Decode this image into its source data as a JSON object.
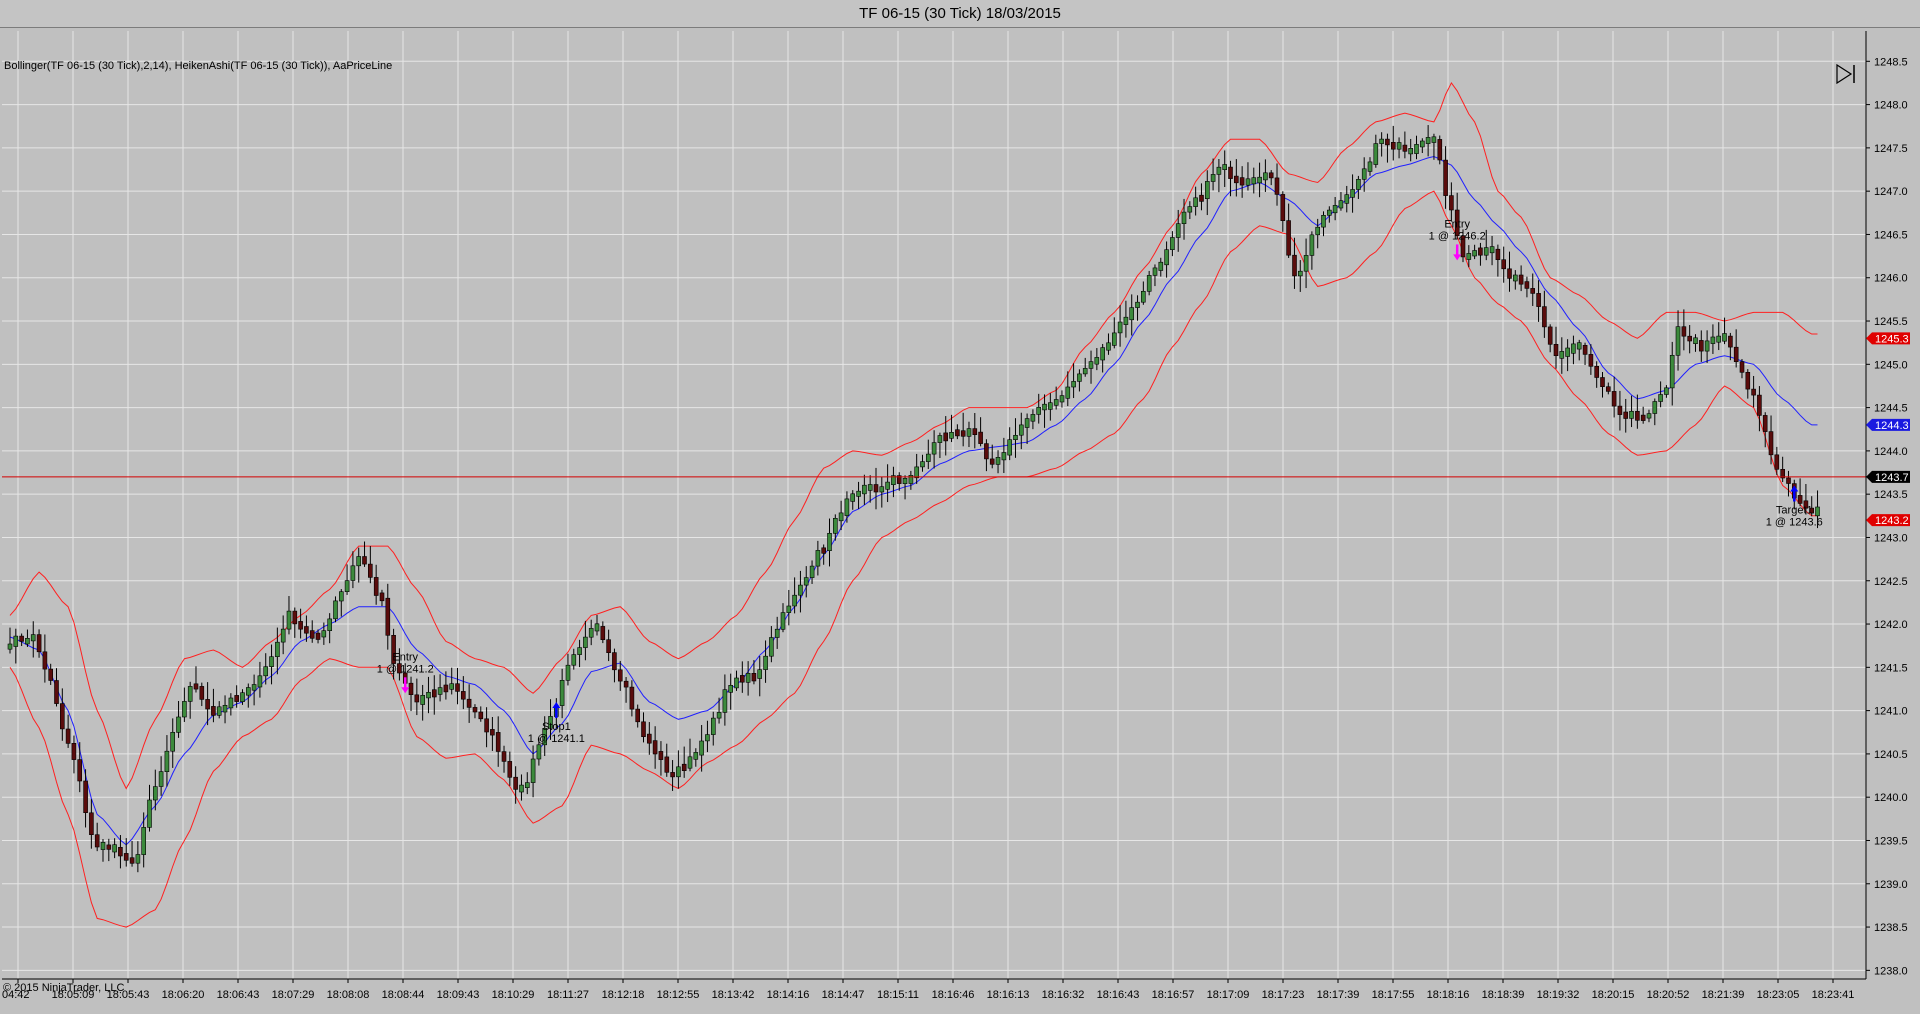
{
  "window": {
    "title": "TF 06-15 (30 Tick)  18/03/2015"
  },
  "chart": {
    "indicators_label": "Bollinger(TF 06-15 (30 Tick),2,14), HeikenAshi(TF 06-15 (30 Tick)), AaPriceLine",
    "copyright": "© 2015 NinjaTrader, LLC"
  },
  "colors": {
    "background": "#c0c0c0",
    "grid": "#e6e6e6",
    "bullish": "#3c8a3c",
    "bearish": "#5a0c0c",
    "bollinger_bands": "#ff2020",
    "bollinger_mid": "#2020ff",
    "price_line": "#d20000",
    "entry_marker": "#ff00ff",
    "exit_marker": "#0000ff"
  },
  "chart_data": {
    "type": "candlestick",
    "subtype": "heiken-ashi",
    "ylim": [
      1237.9,
      1248.85
    ],
    "y_ticks": [
      "1238.0",
      "1238.5",
      "1239.0",
      "1239.5",
      "1240.0",
      "1240.5",
      "1241.0",
      "1241.5",
      "1242.0",
      "1242.5",
      "1243.0",
      "1243.5",
      "1244.0",
      "1244.5",
      "1245.0",
      "1245.5",
      "1246.0",
      "1246.5",
      "1247.0",
      "1247.5",
      "1248.0",
      "1248.5"
    ],
    "x_ticks": [
      "04:42",
      "18:05:09",
      "18:05:43",
      "18:06:20",
      "18:06:43",
      "18:07:29",
      "18:08:08",
      "18:08:44",
      "18:09:43",
      "18:10:29",
      "18:11:27",
      "18:12:18",
      "18:12:55",
      "18:13:42",
      "18:14:16",
      "18:14:47",
      "18:15:11",
      "18:16:46",
      "18:16:13",
      "18:16:32",
      "18:16:43",
      "18:16:57",
      "18:17:09",
      "18:17:23",
      "18:17:39",
      "18:17:55",
      "18:18:16",
      "18:18:39",
      "18:19:32",
      "18:20:15",
      "18:20:52",
      "18:21:39",
      "18:23:05",
      "18:23:41"
    ],
    "grid": true,
    "price_line": 1243.7,
    "badges": [
      {
        "value": "1245.3",
        "price": 1245.3,
        "color": "#e00000"
      },
      {
        "value": "1244.3",
        "price": 1244.3,
        "color": "#1a1ae0"
      },
      {
        "value": "1243.7",
        "price": 1243.7,
        "color": "#000000"
      },
      {
        "value": "1243.2",
        "price": 1243.2,
        "color": "#e00000"
      }
    ],
    "close_anchors": [
      [
        0,
        1241.8
      ],
      [
        4,
        1241.85
      ],
      [
        6,
        1241.5
      ],
      [
        10,
        1240.6
      ],
      [
        15,
        1239.4
      ],
      [
        17,
        1239.45
      ],
      [
        21,
        1239.2
      ],
      [
        25,
        1240.1
      ],
      [
        28,
        1240.7
      ],
      [
        31,
        1241.3
      ],
      [
        35,
        1241.0
      ],
      [
        40,
        1241.15
      ],
      [
        44,
        1241.5
      ],
      [
        48,
        1242.1
      ],
      [
        53,
        1241.8
      ],
      [
        57,
        1242.4
      ],
      [
        60,
        1242.8
      ],
      [
        64,
        1242.25
      ],
      [
        66,
        1241.5
      ],
      [
        70,
        1241.1
      ],
      [
        76,
        1241.3
      ],
      [
        82,
        1240.8
      ],
      [
        88,
        1240.05
      ],
      [
        92,
        1240.8
      ],
      [
        97,
        1241.6
      ],
      [
        101,
        1242.0
      ],
      [
        105,
        1241.4
      ],
      [
        109,
        1240.7
      ],
      [
        114,
        1240.25
      ],
      [
        119,
        1240.6
      ],
      [
        124,
        1241.3
      ],
      [
        128,
        1241.4
      ],
      [
        133,
        1242.1
      ],
      [
        139,
        1242.8
      ],
      [
        144,
        1243.4
      ],
      [
        148,
        1243.55
      ],
      [
        155,
        1243.7
      ],
      [
        160,
        1244.15
      ],
      [
        165,
        1244.25
      ],
      [
        169,
        1243.8
      ],
      [
        174,
        1244.3
      ],
      [
        180,
        1244.6
      ],
      [
        186,
        1245.0
      ],
      [
        192,
        1245.55
      ],
      [
        198,
        1246.2
      ],
      [
        203,
        1246.8
      ],
      [
        208,
        1247.25
      ],
      [
        212,
        1247.15
      ],
      [
        216,
        1247.2
      ],
      [
        218,
        1247.0
      ],
      [
        221,
        1246.0
      ],
      [
        226,
        1246.7
      ],
      [
        232,
        1247.1
      ],
      [
        236,
        1247.6
      ],
      [
        240,
        1247.5
      ],
      [
        245,
        1247.6
      ],
      [
        247,
        1247.0
      ],
      [
        250,
        1246.3
      ],
      [
        254,
        1246.35
      ],
      [
        258,
        1246.0
      ],
      [
        262,
        1245.8
      ],
      [
        266,
        1245.1
      ],
      [
        270,
        1245.2
      ],
      [
        274,
        1244.7
      ],
      [
        278,
        1244.35
      ],
      [
        282,
        1244.45
      ],
      [
        285,
        1244.7
      ],
      [
        287,
        1245.4
      ],
      [
        291,
        1245.2
      ],
      [
        295,
        1245.3
      ],
      [
        300,
        1244.6
      ],
      [
        304,
        1243.8
      ],
      [
        309,
        1243.3
      ]
    ],
    "bollinger_anchors": [
      [
        0,
        1242.1,
        1241.85,
        1241.5
      ],
      [
        5,
        1242.6,
        1241.7,
        1240.8
      ],
      [
        10,
        1242.2,
        1241.0,
        1239.8
      ],
      [
        15,
        1241.0,
        1239.8,
        1238.6
      ],
      [
        20,
        1240.1,
        1239.45,
        1238.5
      ],
      [
        25,
        1240.9,
        1239.9,
        1238.7
      ],
      [
        30,
        1241.6,
        1240.5,
        1239.5
      ],
      [
        35,
        1241.7,
        1240.95,
        1240.3
      ],
      [
        40,
        1241.5,
        1241.1,
        1240.7
      ],
      [
        45,
        1241.8,
        1241.4,
        1240.9
      ],
      [
        50,
        1242.1,
        1241.8,
        1241.35
      ],
      [
        55,
        1242.4,
        1242.0,
        1241.6
      ],
      [
        60,
        1242.9,
        1242.2,
        1241.5
      ],
      [
        65,
        1242.9,
        1242.2,
        1241.5
      ],
      [
        70,
        1242.4,
        1241.7,
        1240.7
      ],
      [
        75,
        1241.8,
        1241.4,
        1240.45
      ],
      [
        80,
        1241.6,
        1241.3,
        1240.5
      ],
      [
        85,
        1241.5,
        1241.0,
        1240.2
      ],
      [
        90,
        1241.2,
        1240.5,
        1239.7
      ],
      [
        95,
        1241.6,
        1240.85,
        1239.9
      ],
      [
        100,
        1242.1,
        1241.45,
        1240.6
      ],
      [
        105,
        1242.2,
        1241.55,
        1240.5
      ],
      [
        110,
        1241.8,
        1241.1,
        1240.3
      ],
      [
        115,
        1241.6,
        1240.9,
        1240.1
      ],
      [
        120,
        1241.8,
        1241.0,
        1240.4
      ],
      [
        125,
        1242.1,
        1241.3,
        1240.6
      ],
      [
        130,
        1242.6,
        1241.7,
        1240.9
      ],
      [
        135,
        1243.2,
        1242.2,
        1241.2
      ],
      [
        140,
        1243.8,
        1242.8,
        1241.8
      ],
      [
        145,
        1244.0,
        1243.3,
        1242.5
      ],
      [
        150,
        1243.95,
        1243.5,
        1243.0
      ],
      [
        155,
        1244.1,
        1243.6,
        1243.2
      ],
      [
        160,
        1244.3,
        1243.85,
        1243.4
      ],
      [
        165,
        1244.5,
        1244.0,
        1243.6
      ],
      [
        170,
        1244.5,
        1244.05,
        1243.7
      ],
      [
        175,
        1244.5,
        1244.1,
        1243.7
      ],
      [
        180,
        1244.7,
        1244.3,
        1243.8
      ],
      [
        185,
        1245.2,
        1244.6,
        1244.0
      ],
      [
        190,
        1245.6,
        1245.0,
        1244.2
      ],
      [
        195,
        1246.1,
        1245.5,
        1244.6
      ],
      [
        200,
        1246.6,
        1246.0,
        1245.2
      ],
      [
        205,
        1247.2,
        1246.5,
        1245.7
      ],
      [
        210,
        1247.6,
        1247.0,
        1246.3
      ],
      [
        215,
        1247.6,
        1247.1,
        1246.6
      ],
      [
        220,
        1247.2,
        1246.9,
        1246.5
      ],
      [
        225,
        1247.1,
        1246.6,
        1245.9
      ],
      [
        230,
        1247.5,
        1246.9,
        1246.0
      ],
      [
        235,
        1247.8,
        1247.2,
        1246.3
      ],
      [
        240,
        1247.9,
        1247.3,
        1246.8
      ],
      [
        245,
        1247.8,
        1247.4,
        1247.0
      ],
      [
        248,
        1248.25,
        1247.3,
        1246.6
      ],
      [
        252,
        1247.8,
        1246.9,
        1246.0
      ],
      [
        256,
        1247.0,
        1246.6,
        1245.7
      ],
      [
        260,
        1246.7,
        1246.3,
        1245.5
      ],
      [
        265,
        1246.0,
        1245.8,
        1245.0
      ],
      [
        270,
        1245.8,
        1245.4,
        1244.6
      ],
      [
        275,
        1245.5,
        1244.9,
        1244.2
      ],
      [
        280,
        1245.3,
        1244.6,
        1243.95
      ],
      [
        285,
        1245.6,
        1244.7,
        1244.0
      ],
      [
        290,
        1245.6,
        1245.0,
        1244.3
      ],
      [
        295,
        1245.5,
        1245.1,
        1244.75
      ],
      [
        300,
        1245.6,
        1245.0,
        1244.5
      ],
      [
        305,
        1245.6,
        1244.6,
        1243.6
      ],
      [
        310,
        1245.35,
        1244.3,
        1243.25
      ]
    ],
    "trades": [
      {
        "label_1": "Entry",
        "label_2": "1 @ 1241.2",
        "price": 1241.2,
        "side": "short",
        "bar": 68
      },
      {
        "label_1": "Stop1",
        "label_2": "1 @ 1241.1",
        "price": 1241.1,
        "side": "buy-to-cover",
        "bar": 94
      },
      {
        "label_1": "Entry",
        "label_2": "1 @ 1246.2",
        "price": 1246.2,
        "side": "short",
        "bar": 249
      },
      {
        "label_1": "Target1",
        "label_2": "1 @ 1243.6",
        "price": 1243.6,
        "side": "buy-to-cover",
        "bar": 307
      }
    ]
  }
}
